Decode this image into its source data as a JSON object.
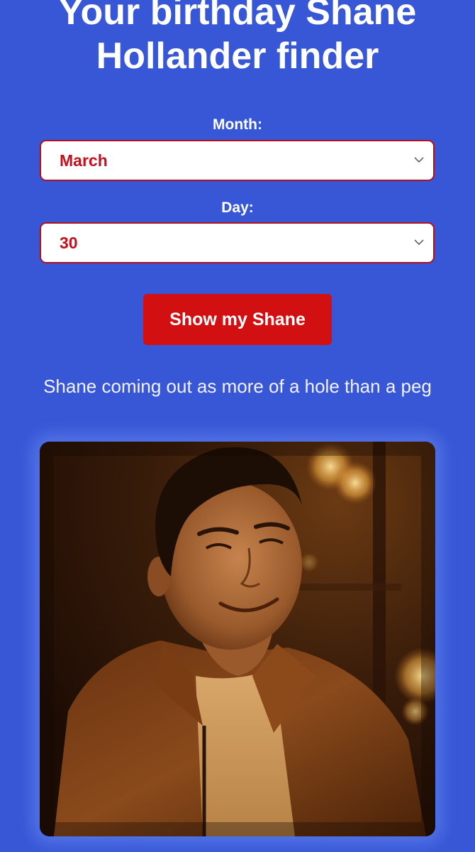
{
  "header": {
    "title": "Your birthday Shane Hollander finder"
  },
  "form": {
    "month_label": "Month:",
    "month_value": "March",
    "day_label": "Day:",
    "day_value": "30",
    "submit_label": "Show my Shane"
  },
  "result": {
    "caption": "Shane coming out as more of a hole than a peg",
    "photo_subject": "smiling man in brown jacket in dim warm-lit room"
  },
  "colors": {
    "background": "#3757d6",
    "accent_red": "#d20f11",
    "select_border": "#b0101d",
    "select_text": "#c4101d"
  },
  "icons": {
    "select_arrow": "chevron-down-icon"
  }
}
